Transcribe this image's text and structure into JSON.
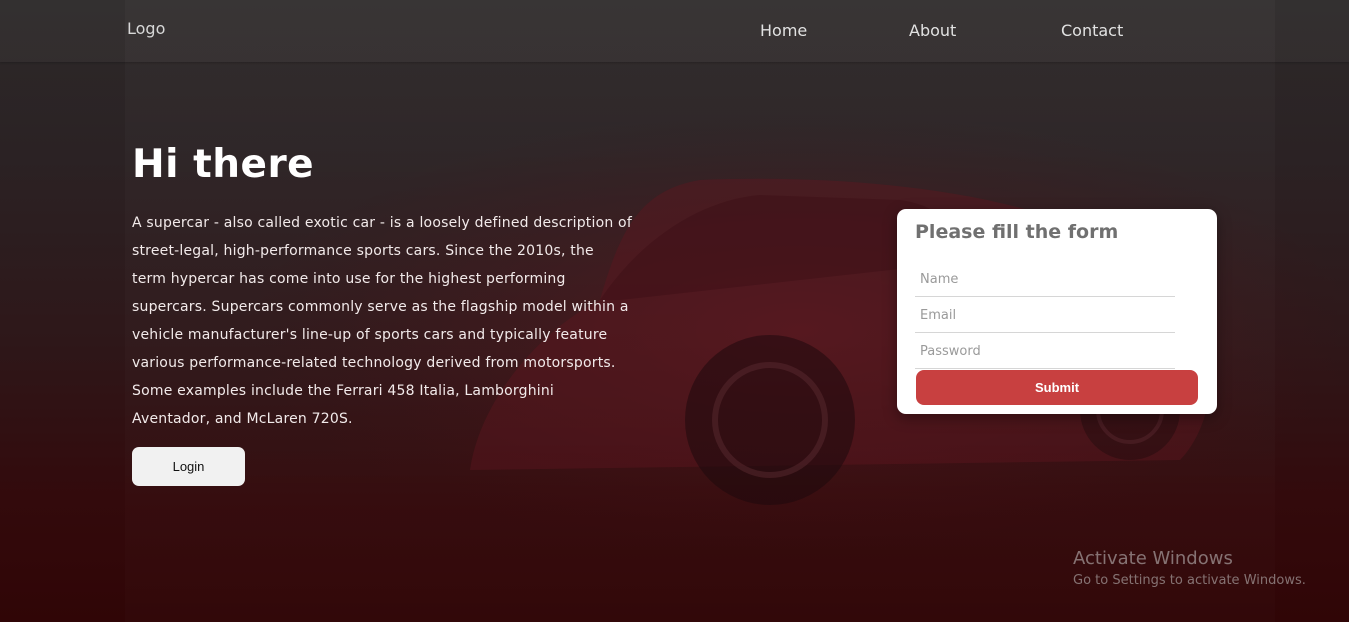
{
  "nav": {
    "logo": "Logo",
    "links": [
      "Home",
      "About",
      "Contact"
    ]
  },
  "hero": {
    "title": "Hi there",
    "description": "A supercar - also called exotic car - is a loosely defined description of street-legal, high-performance sports cars. Since the 2010s, the term hypercar has come into use for the highest performing supercars. Supercars commonly serve as the flagship model within a vehicle manufacturer's line-up of sports cars and typically feature various performance-related technology derived from motorsports. Some examples include the Ferrari 458 Italia, Lamborghini Aventador, and McLaren 720S.",
    "login_label": "Login"
  },
  "form": {
    "title": "Please fill the form",
    "name_placeholder": "Name",
    "email_placeholder": "Email",
    "password_placeholder": "Password",
    "submit_label": "Submit"
  },
  "watermark": {
    "title": "Activate Windows",
    "subtitle": "Go to Settings to activate Windows."
  },
  "colors": {
    "submit": "#c84040",
    "accent_dark_red": "#300506"
  }
}
